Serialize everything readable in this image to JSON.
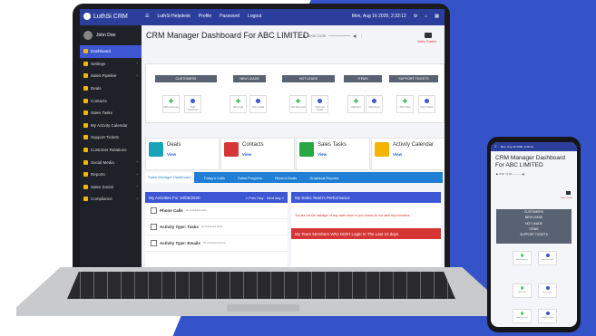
{
  "colors": {
    "accent": "#3553c9",
    "topbar": "#2c3e9c",
    "sidebar": "#1f2128",
    "tabbar": "#1e7fd4",
    "danger": "#d63535",
    "success": "#39b54a"
  },
  "topbar": {
    "brand": "LuthSi CRM",
    "nav": [
      "LuthSi Helpdesk",
      "Profile",
      "Password",
      "Logout"
    ],
    "datetime": "Mon, Aug 16 2020, 2:32:12"
  },
  "sidebar": {
    "user_name": "John Doe",
    "items": [
      {
        "label": "Dashboard",
        "icon": "home-icon",
        "has_caret": false
      },
      {
        "label": "Settings",
        "icon": "wrench-icon",
        "has_caret": true
      },
      {
        "label": "Sales Pipeline",
        "icon": "funnel-icon",
        "has_caret": true
      },
      {
        "label": "Deals",
        "icon": "dollar-icon",
        "has_caret": false
      },
      {
        "label": "Contacts",
        "icon": "contacts-icon",
        "has_caret": false
      },
      {
        "label": "Sales Tasks",
        "icon": "tasks-icon",
        "has_caret": false
      },
      {
        "label": "My Activity Calendar",
        "icon": "calendar-icon",
        "has_caret": false
      },
      {
        "label": "Support Tickets",
        "icon": "ticket-icon",
        "has_caret": false
      },
      {
        "label": "Customer Relations",
        "icon": "handshake-icon",
        "has_caret": false
      },
      {
        "label": "Social Media",
        "icon": "social-icon",
        "has_caret": true
      },
      {
        "label": "Reports",
        "icon": "chart-icon",
        "has_caret": true
      },
      {
        "label": "Sales Social",
        "icon": "chat-icon",
        "has_caret": true
      },
      {
        "label": "Compliance",
        "icon": "check-icon",
        "has_caret": true
      }
    ]
  },
  "main": {
    "title": "CRM Manager Dashboard For ABC LIMITED",
    "audio_time": "0:00 / 0:00",
    "video_label": "Video Guides",
    "categories": [
      "CUSTOMERS",
      "NEW LEADS",
      "HOT LEADS",
      "ITEMS",
      "SUPPORT TICKETS"
    ],
    "quick_buttons": [
      {
        "label": "Add Customer"
      },
      {
        "label": "View Customer"
      },
      {
        "label": "Add Lead"
      },
      {
        "label": "View Leads"
      },
      {
        "label": "Add Hot Lead"
      },
      {
        "label": "View Hot Leads"
      },
      {
        "label": "Add Item"
      },
      {
        "label": "View Items"
      },
      {
        "label": "Add Ticket"
      },
      {
        "label": "View Tickets"
      }
    ],
    "cards": [
      {
        "title": "Deals",
        "link": "View",
        "color": "#17a2b8"
      },
      {
        "title": "Contacts",
        "link": "View",
        "color": "#d63535"
      },
      {
        "title": "Sales Tasks",
        "link": "View",
        "color": "#28a745"
      },
      {
        "title": "Activity Calendar",
        "link": "View",
        "color": "#f5b400"
      }
    ],
    "tabs": [
      "Sales Manager Dashboard",
      "Today's Calls",
      "Sales Progress",
      "Recent Deals",
      "Graphical Reports"
    ],
    "activities": {
      "heading": "My Activities For 16/08/2020",
      "prev": "« Prev Day",
      "next": "Next day »",
      "rows": [
        {
          "label": "Phone Calls",
          "sub": "No Scheduled Calls"
        },
        {
          "label": "Activity Type: Tasks",
          "sub": "No Scheduled Tasks"
        },
        {
          "label": "Activity Type: Emails",
          "sub": "No Scheduled Emails"
        }
      ]
    },
    "team_panel": {
      "heading": "My Sales Team's Performance",
      "message": "You are not the manager of any sales team or your teams do not have any members",
      "heading2": "My Team Members Who Didn't Login In The Last 10 days"
    }
  },
  "phone": {
    "datetime": "Mon, Aug 16 2020, 2:32:12",
    "title": "CRM Manager Dashboard For ABC LIMITED",
    "audio_time": "0:00 / 0:00",
    "video_label": "Video Guides",
    "categories": [
      "CUSTOMERS",
      "NEW LEADS",
      "HOT LEADS",
      "ITEMS",
      "SUPPORT TICKETS"
    ],
    "quick_buttons": [
      {
        "label": "Add Customer"
      },
      {
        "label": "View Customer"
      },
      {
        "label": "Add Lead"
      },
      {
        "label": "View Leads"
      },
      {
        "label": "Add Hot Lead"
      },
      {
        "label": "View Hot Leads"
      }
    ]
  }
}
